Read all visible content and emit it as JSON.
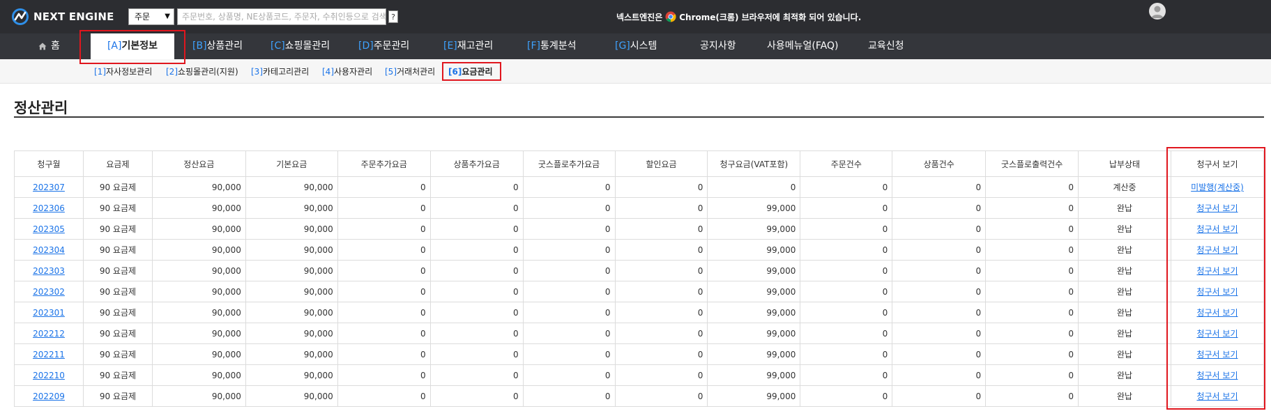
{
  "app": {
    "logo_text": "NEXT ENGINE",
    "search_select": "주문",
    "search_placeholder": "주문번호, 상품명, NE상품코드, 주문자, 수취인등으로 검색",
    "help_label": "?",
    "notice_before": "넥스트엔진은",
    "notice_after": "Chrome(크롬) 브라우저에 최적화 되어 있습니다."
  },
  "mainnav": {
    "home": "홈",
    "items": [
      {
        "code": "[A]",
        "label": "기본정보"
      },
      {
        "code": "[B]",
        "label": "상품관리"
      },
      {
        "code": "[C]",
        "label": "쇼핑몰관리"
      },
      {
        "code": "[D]",
        "label": "주문관리"
      },
      {
        "code": "[E]",
        "label": "재고관리"
      },
      {
        "code": "[F]",
        "label": "통계분석"
      },
      {
        "code": "[G]",
        "label": "시스템"
      }
    ],
    "extra": [
      "공지사항",
      "사용메뉴얼(FAQ)",
      "교육신청"
    ]
  },
  "subnav": {
    "items": [
      {
        "code": "[1]",
        "label": "자사정보관리"
      },
      {
        "code": "[2]",
        "label": "쇼핑몰관리(지원)"
      },
      {
        "code": "[3]",
        "label": "카테고리관리"
      },
      {
        "code": "[4]",
        "label": "사용자관리"
      },
      {
        "code": "[5]",
        "label": "거래처관리"
      },
      {
        "code": "[6]",
        "label": "요금관리"
      }
    ]
  },
  "page": {
    "title": "정산관리"
  },
  "table": {
    "headers": [
      "청구월",
      "요금제",
      "정산요금",
      "기본요금",
      "주문추가요금",
      "상품추가요금",
      "굿스플로추가요금",
      "할인요금",
      "청구요금(VAT포함)",
      "주문건수",
      "상품건수",
      "굿스플로출력건수",
      "납부상태",
      "청구서 보기"
    ],
    "rows": [
      {
        "month": "202307",
        "plan": "90 요금제",
        "settle": "90,000",
        "base": "90,000",
        "order_fee": "0",
        "product_fee": "0",
        "goodsflow_fee": "0",
        "discount": "0",
        "charge": "0",
        "orders": "0",
        "products": "0",
        "gf_count": "0",
        "status": "계산중",
        "invoice": "미발행(계산중)"
      },
      {
        "month": "202306",
        "plan": "90 요금제",
        "settle": "90,000",
        "base": "90,000",
        "order_fee": "0",
        "product_fee": "0",
        "goodsflow_fee": "0",
        "discount": "0",
        "charge": "99,000",
        "orders": "0",
        "products": "0",
        "gf_count": "0",
        "status": "완납",
        "invoice": "청구서 보기"
      },
      {
        "month": "202305",
        "plan": "90 요금제",
        "settle": "90,000",
        "base": "90,000",
        "order_fee": "0",
        "product_fee": "0",
        "goodsflow_fee": "0",
        "discount": "0",
        "charge": "99,000",
        "orders": "0",
        "products": "0",
        "gf_count": "0",
        "status": "완납",
        "invoice": "청구서 보기"
      },
      {
        "month": "202304",
        "plan": "90 요금제",
        "settle": "90,000",
        "base": "90,000",
        "order_fee": "0",
        "product_fee": "0",
        "goodsflow_fee": "0",
        "discount": "0",
        "charge": "99,000",
        "orders": "0",
        "products": "0",
        "gf_count": "0",
        "status": "완납",
        "invoice": "청구서 보기"
      },
      {
        "month": "202303",
        "plan": "90 요금제",
        "settle": "90,000",
        "base": "90,000",
        "order_fee": "0",
        "product_fee": "0",
        "goodsflow_fee": "0",
        "discount": "0",
        "charge": "99,000",
        "orders": "0",
        "products": "0",
        "gf_count": "0",
        "status": "완납",
        "invoice": "청구서 보기"
      },
      {
        "month": "202302",
        "plan": "90 요금제",
        "settle": "90,000",
        "base": "90,000",
        "order_fee": "0",
        "product_fee": "0",
        "goodsflow_fee": "0",
        "discount": "0",
        "charge": "99,000",
        "orders": "0",
        "products": "0",
        "gf_count": "0",
        "status": "완납",
        "invoice": "청구서 보기"
      },
      {
        "month": "202301",
        "plan": "90 요금제",
        "settle": "90,000",
        "base": "90,000",
        "order_fee": "0",
        "product_fee": "0",
        "goodsflow_fee": "0",
        "discount": "0",
        "charge": "99,000",
        "orders": "0",
        "products": "0",
        "gf_count": "0",
        "status": "완납",
        "invoice": "청구서 보기"
      },
      {
        "month": "202212",
        "plan": "90 요금제",
        "settle": "90,000",
        "base": "90,000",
        "order_fee": "0",
        "product_fee": "0",
        "goodsflow_fee": "0",
        "discount": "0",
        "charge": "99,000",
        "orders": "0",
        "products": "0",
        "gf_count": "0",
        "status": "완납",
        "invoice": "청구서 보기"
      },
      {
        "month": "202211",
        "plan": "90 요금제",
        "settle": "90,000",
        "base": "90,000",
        "order_fee": "0",
        "product_fee": "0",
        "goodsflow_fee": "0",
        "discount": "0",
        "charge": "99,000",
        "orders": "0",
        "products": "0",
        "gf_count": "0",
        "status": "완납",
        "invoice": "청구서 보기"
      },
      {
        "month": "202210",
        "plan": "90 요금제",
        "settle": "90,000",
        "base": "90,000",
        "order_fee": "0",
        "product_fee": "0",
        "goodsflow_fee": "0",
        "discount": "0",
        "charge": "99,000",
        "orders": "0",
        "products": "0",
        "gf_count": "0",
        "status": "완납",
        "invoice": "청구서 보기"
      },
      {
        "month": "202209",
        "plan": "90 요금제",
        "settle": "90,000",
        "base": "90,000",
        "order_fee": "0",
        "product_fee": "0",
        "goodsflow_fee": "0",
        "discount": "0",
        "charge": "99,000",
        "orders": "0",
        "products": "0",
        "gf_count": "0",
        "status": "완납",
        "invoice": "청구서 보기"
      }
    ]
  },
  "colors": {
    "topbar": "#2c2d31",
    "nav": "#34363b",
    "accent": "#1a73e8",
    "highlight": "#e0161e"
  }
}
